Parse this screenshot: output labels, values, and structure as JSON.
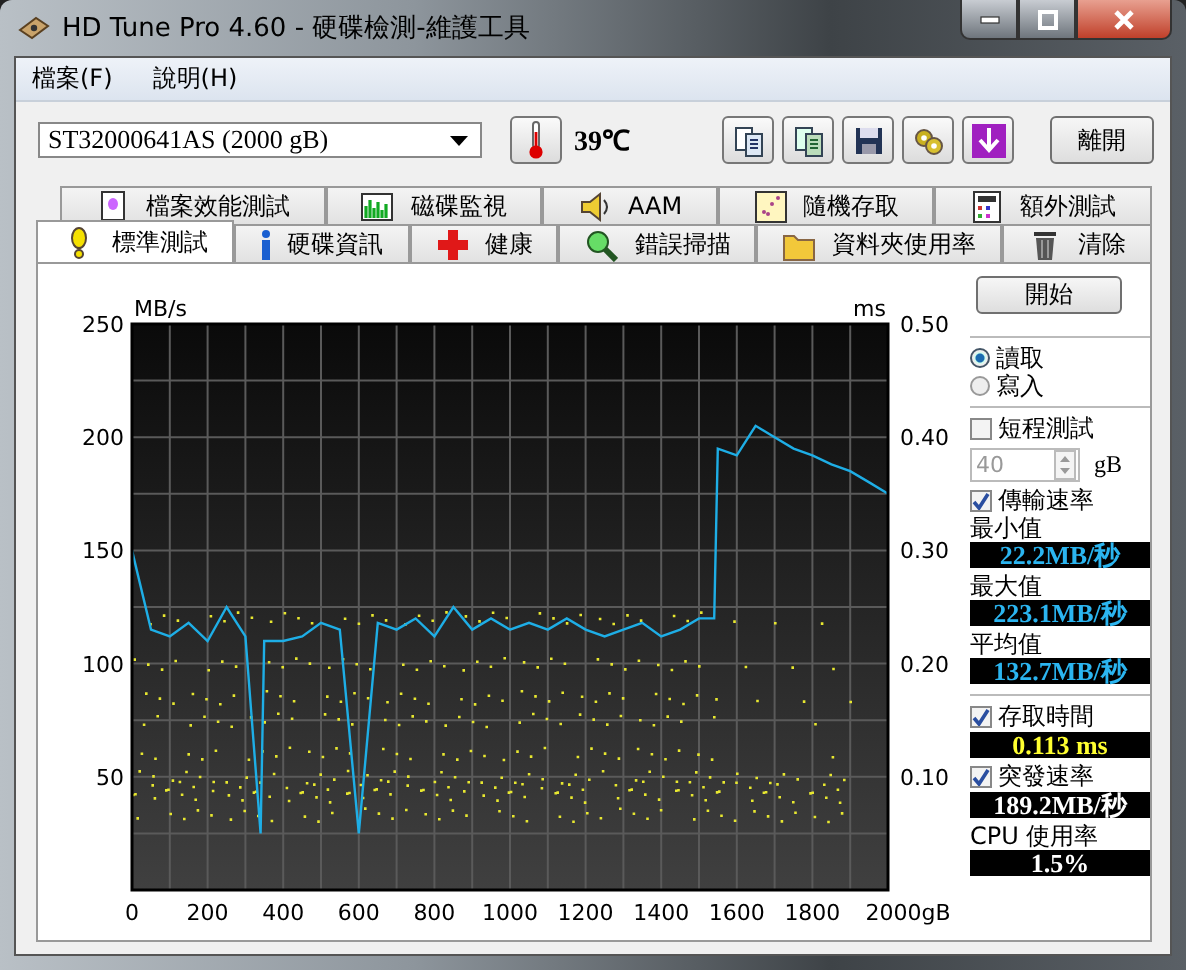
{
  "window": {
    "title": "HD Tune Pro 4.60 - 硬碟檢測-維護工具"
  },
  "menu": [
    "檔案(F)",
    "說明(H)"
  ],
  "toolbar": {
    "drive": "ST32000641AS (2000 gB)",
    "temperature": "39℃",
    "exit_button": "離開"
  },
  "tab_rows": [
    [
      {
        "label": "檔案效能測試",
        "selected": false
      },
      {
        "label": "磁碟監視",
        "selected": false
      },
      {
        "label": "AAM",
        "selected": false
      },
      {
        "label": "隨機存取",
        "selected": false
      },
      {
        "label": "額外測試",
        "selected": false
      }
    ],
    [
      {
        "label": "標準測試",
        "selected": true
      },
      {
        "label": "硬碟資訊",
        "selected": false
      },
      {
        "label": "健康",
        "selected": false
      },
      {
        "label": "錯誤掃描",
        "selected": false
      },
      {
        "label": "資料夾使用率",
        "selected": false
      },
      {
        "label": "清除",
        "selected": false
      }
    ]
  ],
  "side": {
    "start_button": "開始",
    "modes": [
      {
        "label": "讀取",
        "selected": true
      },
      {
        "label": "寫入",
        "selected": false
      }
    ],
    "short_test": {
      "label": "短程測試",
      "checked": false,
      "value": "40",
      "unit": "gB"
    },
    "transfer_rate": {
      "label": "傳輸速率",
      "checked": true
    },
    "stats": [
      {
        "label": "最小值",
        "value": "22.2MB/秒",
        "kind": "rate"
      },
      {
        "label": "最大值",
        "value": "223.1MB/秒",
        "kind": "rate"
      },
      {
        "label": "平均值",
        "value": "132.7MB/秒",
        "kind": "rate"
      }
    ],
    "access_time": {
      "label": "存取時間",
      "checked": true,
      "value": "0.113 ms",
      "kind": "time"
    },
    "burst_rate": {
      "label": "突發速率",
      "checked": true,
      "value": "189.2MB/秒",
      "kind": "plain"
    },
    "cpu": {
      "label": "CPU 使用率",
      "value": "1.5%",
      "kind": "plain"
    }
  },
  "chart": {
    "y2label": "ms",
    "y2ticks": [
      "0.50",
      "0.40",
      "0.30",
      "0.20",
      "0.10"
    ],
    "chart_data": {
      "type": "line",
      "grid": true,
      "ylabel": "MB/s",
      "xlim": [
        0,
        2000
      ],
      "ylim": [
        0,
        250
      ],
      "xticks": [
        0,
        200,
        400,
        600,
        800,
        1000,
        1200,
        1400,
        1600,
        1800,
        {
          "value": 2000,
          "label": "2000gB"
        }
      ],
      "yticks": [
        50,
        100,
        150,
        200,
        250
      ],
      "x": [
        0,
        50,
        100,
        150,
        200,
        250,
        300,
        340,
        350,
        400,
        450,
        500,
        550,
        600,
        650,
        700,
        750,
        800,
        850,
        900,
        950,
        1000,
        1050,
        1100,
        1150,
        1200,
        1250,
        1300,
        1350,
        1400,
        1450,
        1500,
        1540,
        1550,
        1600,
        1650,
        1700,
        1750,
        1800,
        1850,
        1900,
        1950,
        2000
      ],
      "series": [
        {
          "color": "#1eaee6",
          "values": [
            150,
            115,
            112,
            118,
            110,
            125,
            112,
            25,
            110,
            110,
            112,
            118,
            115,
            25,
            118,
            115,
            120,
            112,
            125,
            115,
            120,
            115,
            118,
            115,
            120,
            115,
            112,
            115,
            118,
            112,
            115,
            120,
            120,
            195,
            192,
            205,
            200,
            195,
            192,
            188,
            185,
            180,
            175
          ]
        }
      ]
    }
  }
}
